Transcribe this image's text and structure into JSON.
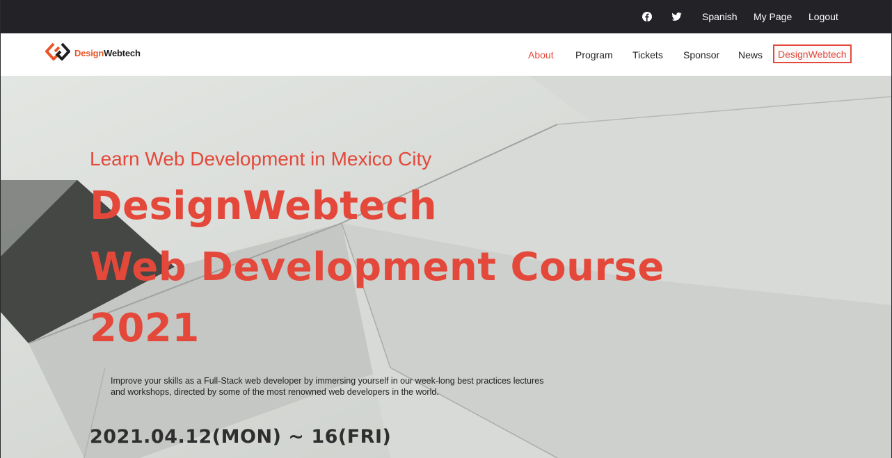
{
  "topbar": {
    "facebook_icon": "facebook-icon",
    "twitter_icon": "twitter-icon",
    "language": "Spanish",
    "my_page": "My Page",
    "logout": "Logout"
  },
  "brand": {
    "name_part1": "Design",
    "name_part2": "Webtech",
    "accent_color": "#e4483a",
    "logo_orange": "#e8572a"
  },
  "nav": {
    "items": [
      {
        "label": "About"
      },
      {
        "label": "Program"
      },
      {
        "label": "Tickets"
      },
      {
        "label": "Sponsor"
      },
      {
        "label": "News"
      },
      {
        "label": "DesignWebtech"
      }
    ]
  },
  "hero": {
    "subtitle": "Learn Web Development in Mexico City",
    "title_lines": [
      "DesignWebtech",
      "Web Development Course",
      "2021"
    ],
    "description": "Improve your skills as a Full-Stack web developer by immersing yourself in our week-long best practices lectures and workshops, directed by some of the most renowned web developers in the world.",
    "date": "2021.04.12(MON) ~ 16(FRI)"
  }
}
